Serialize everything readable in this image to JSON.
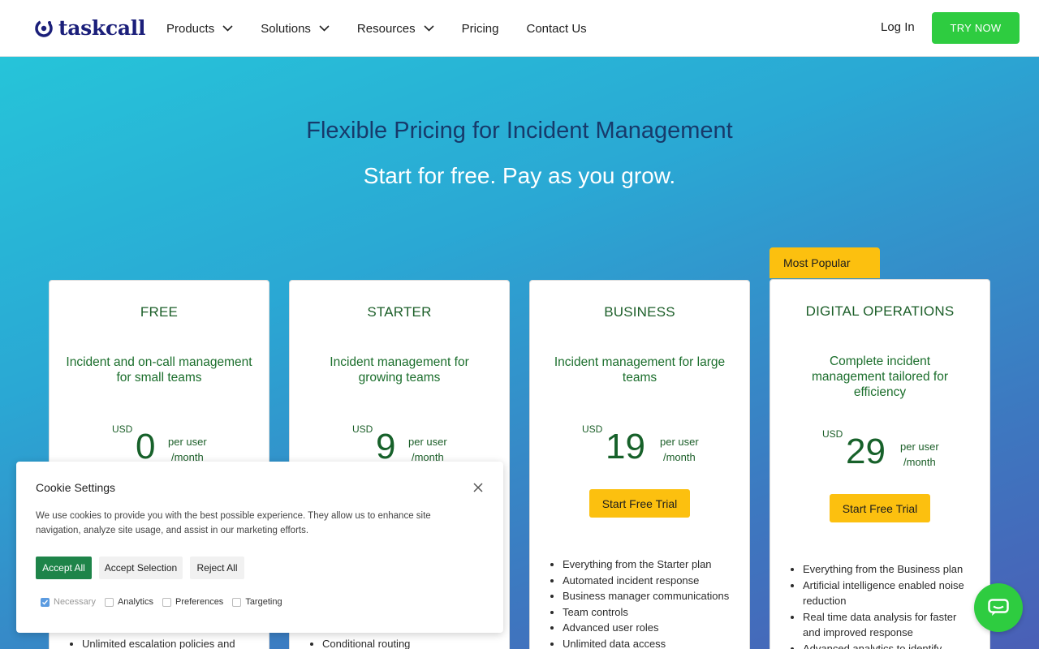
{
  "brand": {
    "name": "taskcall"
  },
  "nav": {
    "items": [
      {
        "label": "Products",
        "dropdown": true
      },
      {
        "label": "Solutions",
        "dropdown": true
      },
      {
        "label": "Resources",
        "dropdown": true
      },
      {
        "label": "Pricing",
        "dropdown": false
      },
      {
        "label": "Contact Us",
        "dropdown": false
      }
    ],
    "login": "Log In",
    "try_now": "TRY NOW"
  },
  "hero": {
    "title": "Flexible Pricing for Incident Management",
    "subtitle": "Start for free. Pay as you grow."
  },
  "badge": "Most Popular",
  "plans": [
    {
      "name": "FREE",
      "description": "Incident and on-call management for small teams",
      "currency": "USD",
      "price": "0",
      "per_line1": "per user",
      "per_line2": "/month",
      "features": [
        "Unlimited escalation policies and"
      ]
    },
    {
      "name": "STARTER",
      "description": "Incident management for growing teams",
      "currency": "USD",
      "price": "9",
      "per_line1": "per user",
      "per_line2": "/month",
      "features": [
        "Conditional routing"
      ]
    },
    {
      "name": "BUSINESS",
      "description": "Incident management for large teams",
      "currency": "USD",
      "price": "19",
      "per_line1": "per user",
      "per_line2": "/month",
      "cta": "Start Free Trial",
      "features": [
        "Everything from the Starter plan",
        "Automated incident response",
        "Business manager communications",
        "Team controls",
        "Advanced user roles",
        "Unlimited data access"
      ]
    },
    {
      "name": "DIGITAL OPERATIONS",
      "description": "Complete incident management tailored for efficiency",
      "currency": "USD",
      "price": "29",
      "per_line1": "per user",
      "per_line2": "/month",
      "cta": "Start Free Trial",
      "features": [
        "Everything from the Business plan",
        "Artificial intelligence enabled noise reduction",
        "Real time data analysis for faster and improved response",
        "Advanced analytics to identify"
      ]
    }
  ],
  "cookie": {
    "title": "Cookie Settings",
    "text": "We use cookies to provide you with the best possible experience. They allow us to enhance site navigation, analyze site usage, and assist in our marketing efforts.",
    "accept_all": "Accept All",
    "accept_selection": "Accept Selection",
    "reject_all": "Reject All",
    "options": [
      {
        "label": "Necessary",
        "checked": true,
        "disabled": true
      },
      {
        "label": "Analytics",
        "checked": false
      },
      {
        "label": "Preferences",
        "checked": false
      },
      {
        "label": "Targeting",
        "checked": false
      }
    ]
  },
  "colors": {
    "brand_navy": "#1b1f7a",
    "cta_green": "#2ecc40",
    "plan_green": "#1b5e28",
    "trial_yellow": "#fcc00f"
  }
}
